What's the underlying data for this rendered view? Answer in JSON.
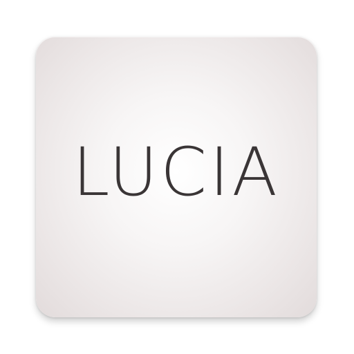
{
  "app_icon": {
    "wordmark": "LUCIA"
  },
  "colors": {
    "icon_background": "#f4f1f1",
    "icon_edge": "#e2dbdb",
    "wordmark_text": "#3a3536"
  }
}
